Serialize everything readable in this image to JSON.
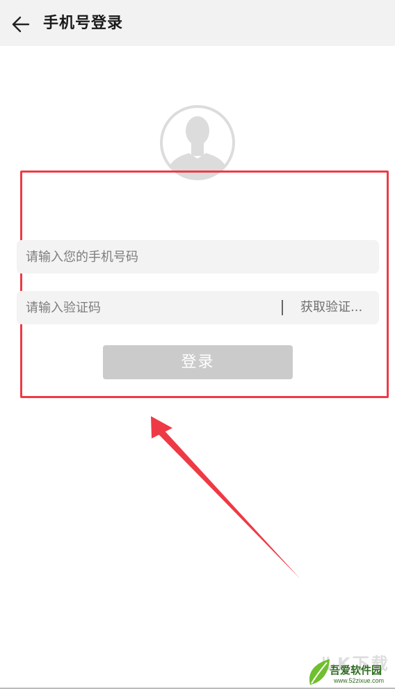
{
  "header": {
    "back_icon": "arrow-left-icon",
    "title": "手机号登录"
  },
  "avatar": {
    "icon": "user-avatar-icon"
  },
  "form": {
    "phone_placeholder": "请输入您的手机号码",
    "phone_value": "",
    "code_placeholder": "请输入验证码",
    "code_value": "",
    "get_code_label": "获取验证...",
    "login_label": "登录"
  },
  "annotation": {
    "frame_color": "#ee3a45",
    "arrow_color": "#ee3a45"
  },
  "watermark": {
    "ghost_text": "ルK下载",
    "brand": "吾爱软件园",
    "url": "www.52zixue.com"
  },
  "colors": {
    "header_bg": "#f2f2f2",
    "field_bg": "#f3f3f3",
    "login_button_bg": "#cbcbcb"
  }
}
